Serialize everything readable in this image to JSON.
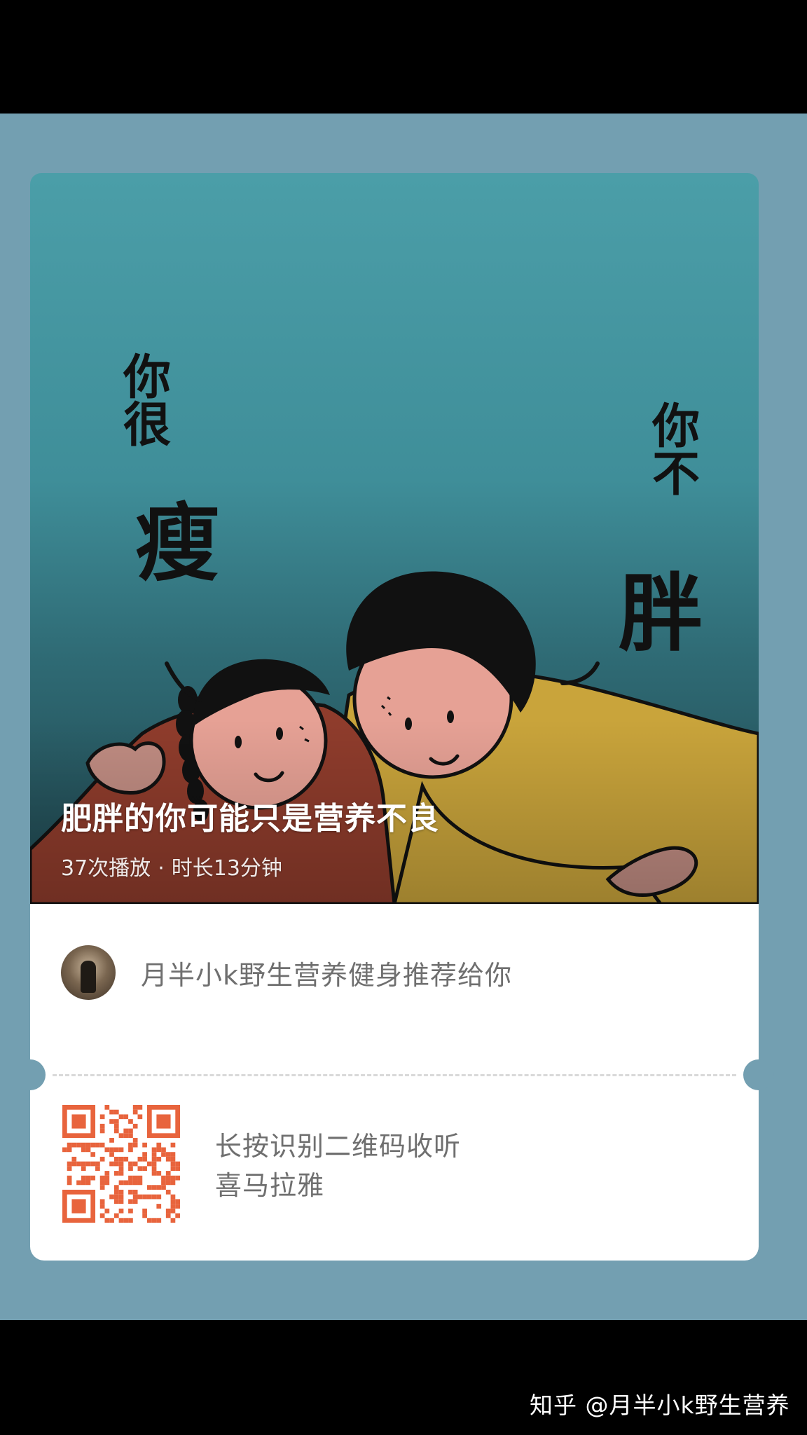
{
  "cover": {
    "title": "肥胖的你可能只是营养不良",
    "play_count": "37次播放",
    "separator": "·",
    "duration": "时长13分钟",
    "illustration_text": {
      "left_small": "你很",
      "left_big": "瘦",
      "right_small": "你不",
      "right_big": "胖"
    }
  },
  "recommend": {
    "text": "月半小k野生营养健身推荐给你"
  },
  "qr": {
    "line1": "长按识别二维码收听",
    "line2": "喜马拉雅"
  },
  "watermark": "知乎 @月半小k野生营养",
  "colors": {
    "background": "#739fb1",
    "qr": "#e8643d",
    "cover_top": "#4b9ea8"
  }
}
